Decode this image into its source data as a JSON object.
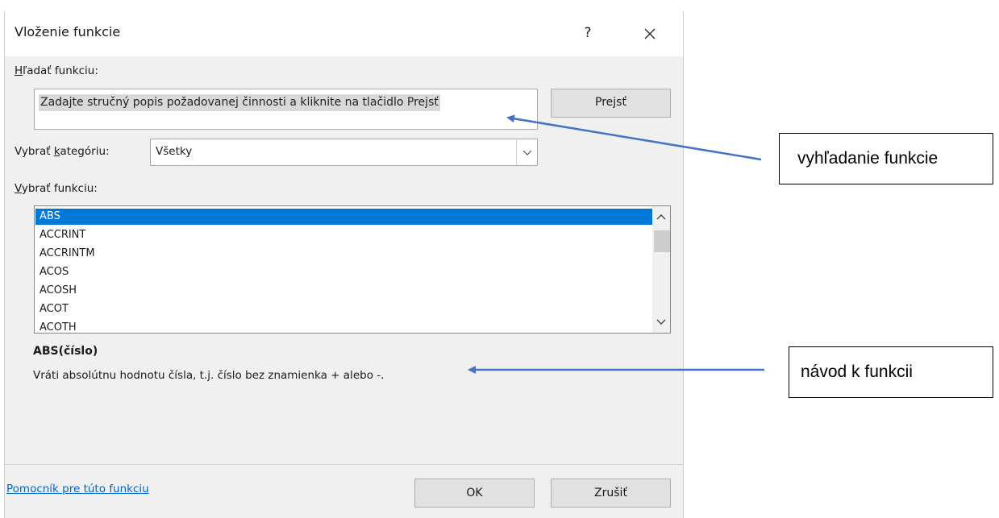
{
  "dialog": {
    "title": "Vloženie funkcie",
    "help_glyph": "?",
    "search_label_hotkey": "H",
    "search_label_rest": "ľadať funkciu:",
    "search_value": "Zadajte stručný popis požadovanej činnosti a kliknite na tlačidlo Prejsť",
    "go_button": "Prejsť",
    "category_label_before": "Vybrať ",
    "category_label_hotkey": "k",
    "category_label_after": "ategóriu:",
    "category_selected": "Všetky",
    "function_label_hotkey": "V",
    "function_label_rest": "ybrať funkciu:",
    "functions": [
      "ABS",
      "ACCRINT",
      "ACCRINTM",
      "ACOS",
      "ACOSH",
      "ACOT",
      "ACOTH"
    ],
    "selected_function": "ABS",
    "signature": "ABS(číslo)",
    "description": "Vráti absolútnu hodnotu čísla, t.j. číslo bez znamienka + alebo -.",
    "help_link": "Pomocník pre túto funkciu",
    "ok_button": "OK",
    "cancel_button": "Zrušiť"
  },
  "callouts": {
    "search": "vyhľadanie funkcie",
    "guide": "návod k funkcii"
  },
  "colors": {
    "accent": "#0078d7",
    "arrow": "#4472c4",
    "link": "#0066cc",
    "dialog_bg": "#f0f0f0"
  },
  "icons": {
    "close": "close-icon",
    "dropdown": "chevron-down-icon",
    "scroll_up": "chevron-up-icon",
    "scroll_down": "chevron-down-icon"
  }
}
